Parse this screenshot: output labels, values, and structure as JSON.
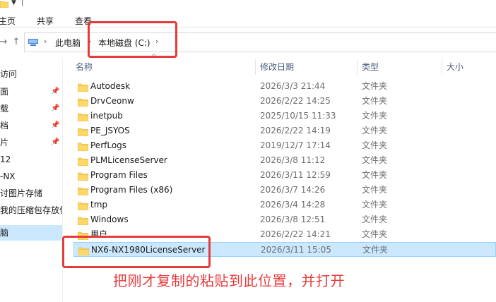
{
  "ribbon": {
    "tabs": [
      "主页",
      "共享",
      "查看"
    ]
  },
  "address": {
    "crumbs": [
      "此电脑",
      "本地磁盘 (C:)"
    ]
  },
  "sidebar": {
    "items": [
      {
        "label": "访问",
        "pinned": false
      },
      {
        "label": "面",
        "pinned": true
      },
      {
        "label": "载",
        "pinned": true
      },
      {
        "label": "档",
        "pinned": true
      },
      {
        "label": "片",
        "pinned": true
      },
      {
        "label": "12",
        "pinned": false
      },
      {
        "label": "-NX",
        "pinned": false
      },
      {
        "label": "讨图片存储",
        "pinned": false
      },
      {
        "label": "我的压缩包存放位",
        "pinned": false
      },
      {
        "label": "脑",
        "pinned": false,
        "selected": true
      }
    ]
  },
  "columns": {
    "name": "名称",
    "date": "修改日期",
    "type": "类型",
    "size": "大小"
  },
  "files": [
    {
      "name": "Autodesk",
      "date": "2026/3/3 21:44",
      "type": "文件夹"
    },
    {
      "name": "DrvCeonw",
      "date": "2026/2/22 14:25",
      "type": "文件夹"
    },
    {
      "name": "inetpub",
      "date": "2025/10/15 11:33",
      "type": "文件夹"
    },
    {
      "name": "PE_JSYOS",
      "date": "2026/2/22 14:19",
      "type": "文件夹"
    },
    {
      "name": "PerfLogs",
      "date": "2019/12/7 17:14",
      "type": "文件夹"
    },
    {
      "name": "PLMLicenseServer",
      "date": "2026/3/8 11:12",
      "type": "文件夹"
    },
    {
      "name": "Program Files",
      "date": "2026/3/11 12:59",
      "type": "文件夹"
    },
    {
      "name": "Program Files (x86)",
      "date": "2026/3/7 14:26",
      "type": "文件夹"
    },
    {
      "name": "tmp",
      "date": "2026/3/4 14:28",
      "type": "文件夹"
    },
    {
      "name": "Windows",
      "date": "2026/3/8 12:51",
      "type": "文件夹"
    },
    {
      "name": "用户",
      "date": "2026/2/22 14:21",
      "type": "文件夹"
    },
    {
      "name": "NX6-NX1980LicenseServer",
      "date": "2026/3/11 15:05",
      "type": "文件夹",
      "selected": true
    }
  ],
  "annotation": "把刚才复制的粘贴到此位置，并打开",
  "colors": {
    "highlight_red": "#e63b3b",
    "selection_blue": "#cce8ff",
    "folder_yellow": "#ffd867"
  }
}
